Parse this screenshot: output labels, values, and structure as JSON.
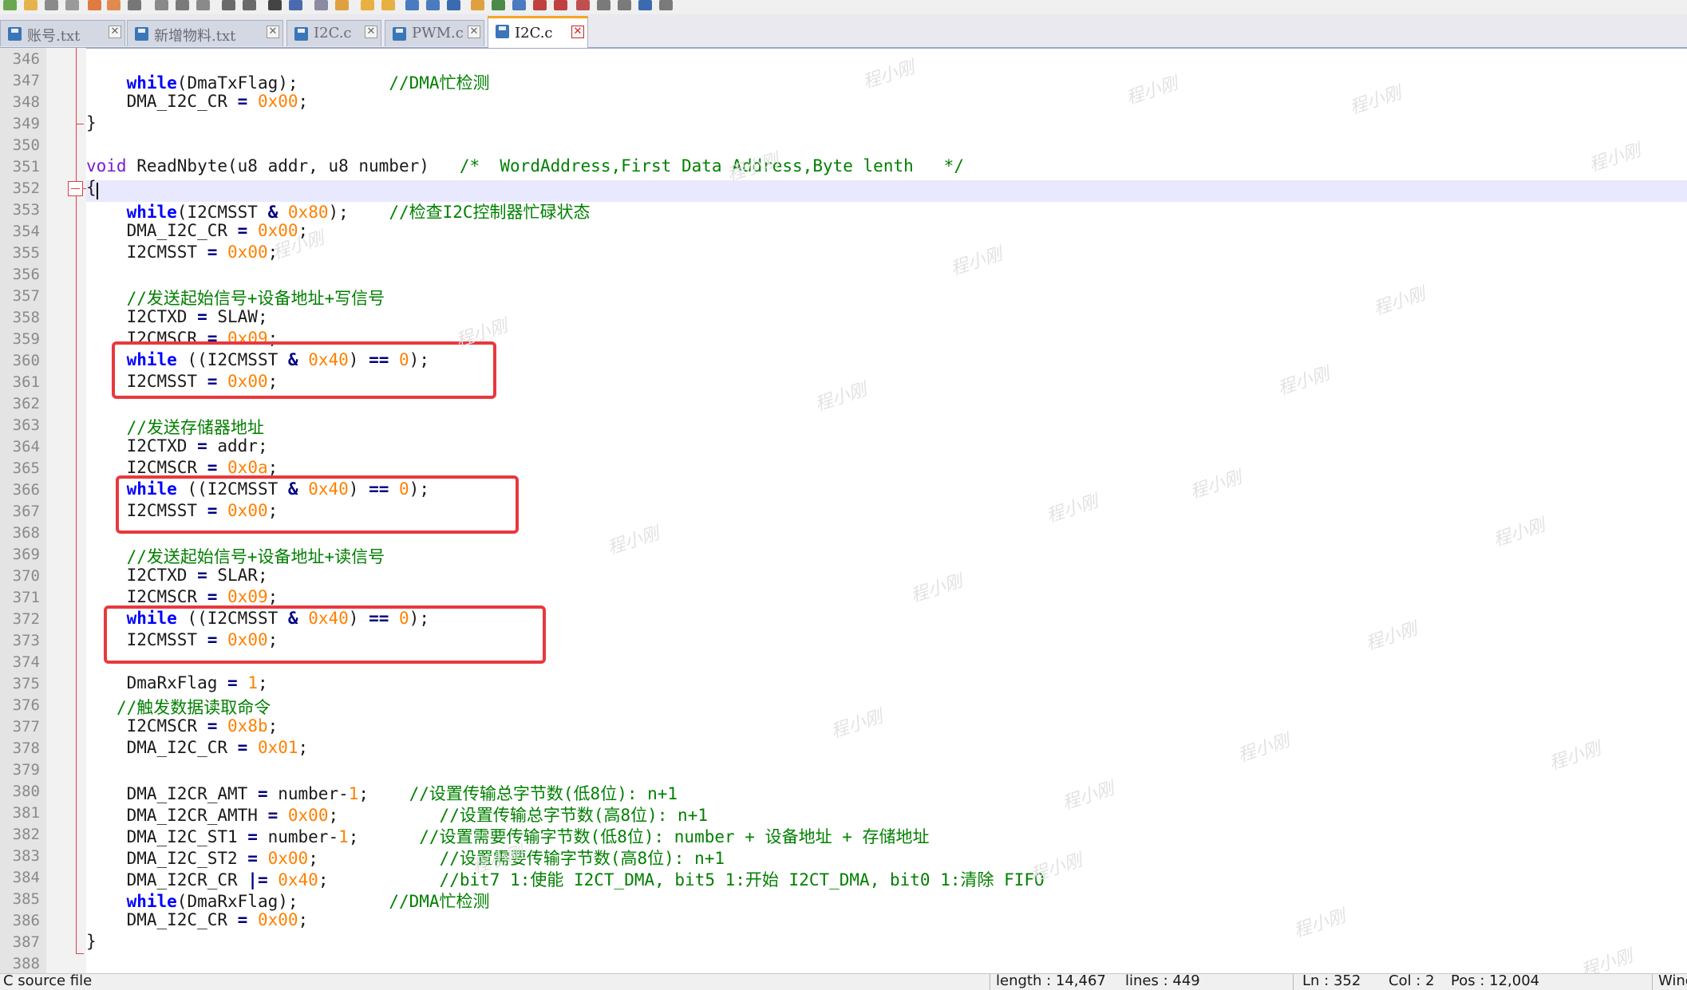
{
  "tabs": [
    {
      "label": "账号.txt",
      "active": false
    },
    {
      "label": "新增物料.txt",
      "active": false
    },
    {
      "label": "I2C.c",
      "active": false
    },
    {
      "label": "PWM.c",
      "active": false
    },
    {
      "label": "I2C.c",
      "active": true
    }
  ],
  "tab_close_glyph": "✕",
  "watermark_text": "程小刚",
  "colors": {
    "keyword": "#0000ff",
    "type": "#7a1cd0",
    "number": "#ff8000",
    "operator": "#000080",
    "comment": "#008000",
    "highlight_box": "#e8383d",
    "current_line": "#e8e8ff"
  },
  "editor": {
    "current_line": 352,
    "lines": [
      {
        "n": "346",
        "t": []
      },
      {
        "n": "347",
        "t": [
          [
            "    ",
            ""
          ],
          [
            "while",
            "kw"
          ],
          [
            "(DmaTxFlag);         ",
            ""
          ],
          [
            "//DMA忙检测",
            "cm"
          ]
        ]
      },
      {
        "n": "348",
        "t": [
          [
            "    DMA_I2C_CR ",
            ""
          ],
          [
            "=",
            "op"
          ],
          [
            " ",
            ""
          ],
          [
            "0x00",
            "num"
          ],
          [
            ";",
            ""
          ]
        ]
      },
      {
        "n": "349",
        "t": [
          [
            "}",
            ""
          ]
        ]
      },
      {
        "n": "350",
        "t": []
      },
      {
        "n": "351",
        "t": [
          [
            "void",
            "ty"
          ],
          [
            " ReadNbyte(u8 addr, u8 number)   ",
            ""
          ],
          [
            "/*  WordAddress,First Data Address,Byte lenth   */",
            "cm"
          ]
        ]
      },
      {
        "n": "352",
        "t": [
          [
            "{",
            ""
          ]
        ]
      },
      {
        "n": "353",
        "t": [
          [
            "    ",
            ""
          ],
          [
            "while",
            "kw"
          ],
          [
            "(I2CMSST ",
            ""
          ],
          [
            "&",
            "op"
          ],
          [
            " ",
            ""
          ],
          [
            "0x80",
            "num"
          ],
          [
            ");    ",
            ""
          ],
          [
            "//检查I2C控制器忙碌状态",
            "cm"
          ]
        ]
      },
      {
        "n": "354",
        "t": [
          [
            "    DMA_I2C_CR ",
            ""
          ],
          [
            "=",
            "op"
          ],
          [
            " ",
            ""
          ],
          [
            "0x00",
            "num"
          ],
          [
            ";",
            ""
          ]
        ]
      },
      {
        "n": "355",
        "t": [
          [
            "    I2CMSST ",
            ""
          ],
          [
            "=",
            "op"
          ],
          [
            " ",
            ""
          ],
          [
            "0x00",
            "num"
          ],
          [
            ";",
            ""
          ]
        ]
      },
      {
        "n": "356",
        "t": []
      },
      {
        "n": "357",
        "t": [
          [
            "    ",
            ""
          ],
          [
            "//发送起始信号+设备地址+写信号",
            "cm"
          ]
        ]
      },
      {
        "n": "358",
        "t": [
          [
            "    I2CTXD ",
            ""
          ],
          [
            "=",
            "op"
          ],
          [
            " SLAW;",
            ""
          ]
        ]
      },
      {
        "n": "359",
        "t": [
          [
            "    I2CMSCR ",
            ""
          ],
          [
            "=",
            "op"
          ],
          [
            " ",
            ""
          ],
          [
            "0x09",
            "num"
          ],
          [
            ";",
            ""
          ]
        ]
      },
      {
        "n": "360",
        "t": [
          [
            "    ",
            ""
          ],
          [
            "while",
            "kw"
          ],
          [
            " ((I2CMSST ",
            ""
          ],
          [
            "&",
            "op"
          ],
          [
            " ",
            ""
          ],
          [
            "0x40",
            "num"
          ],
          [
            ") ",
            ""
          ],
          [
            "==",
            "op"
          ],
          [
            " ",
            ""
          ],
          [
            "0",
            "num"
          ],
          [
            ");",
            ""
          ]
        ]
      },
      {
        "n": "361",
        "t": [
          [
            "    I2CMSST ",
            ""
          ],
          [
            "=",
            "op"
          ],
          [
            " ",
            ""
          ],
          [
            "0x00",
            "num"
          ],
          [
            ";",
            ""
          ]
        ]
      },
      {
        "n": "362",
        "t": []
      },
      {
        "n": "363",
        "t": [
          [
            "    ",
            ""
          ],
          [
            "//发送存储器地址",
            "cm"
          ]
        ]
      },
      {
        "n": "364",
        "t": [
          [
            "    I2CTXD ",
            ""
          ],
          [
            "=",
            "op"
          ],
          [
            " addr;",
            ""
          ]
        ]
      },
      {
        "n": "365",
        "t": [
          [
            "    I2CMSCR ",
            ""
          ],
          [
            "=",
            "op"
          ],
          [
            " ",
            ""
          ],
          [
            "0x0a",
            "num"
          ],
          [
            ";",
            ""
          ]
        ]
      },
      {
        "n": "366",
        "t": [
          [
            "    ",
            ""
          ],
          [
            "while",
            "kw"
          ],
          [
            " ((I2CMSST ",
            ""
          ],
          [
            "&",
            "op"
          ],
          [
            " ",
            ""
          ],
          [
            "0x40",
            "num"
          ],
          [
            ") ",
            ""
          ],
          [
            "==",
            "op"
          ],
          [
            " ",
            ""
          ],
          [
            "0",
            "num"
          ],
          [
            ");",
            ""
          ]
        ]
      },
      {
        "n": "367",
        "t": [
          [
            "    I2CMSST ",
            ""
          ],
          [
            "=",
            "op"
          ],
          [
            " ",
            ""
          ],
          [
            "0x00",
            "num"
          ],
          [
            ";",
            ""
          ]
        ]
      },
      {
        "n": "368",
        "t": []
      },
      {
        "n": "369",
        "t": [
          [
            "    ",
            ""
          ],
          [
            "//发送起始信号+设备地址+读信号",
            "cm"
          ]
        ]
      },
      {
        "n": "370",
        "t": [
          [
            "    I2CTXD ",
            ""
          ],
          [
            "=",
            "op"
          ],
          [
            " SLAR;",
            ""
          ]
        ]
      },
      {
        "n": "371",
        "t": [
          [
            "    I2CMSCR ",
            ""
          ],
          [
            "=",
            "op"
          ],
          [
            " ",
            ""
          ],
          [
            "0x09",
            "num"
          ],
          [
            ";",
            ""
          ]
        ]
      },
      {
        "n": "372",
        "t": [
          [
            "    ",
            ""
          ],
          [
            "while",
            "kw"
          ],
          [
            " ((I2CMSST ",
            ""
          ],
          [
            "&",
            "op"
          ],
          [
            " ",
            ""
          ],
          [
            "0x40",
            "num"
          ],
          [
            ") ",
            ""
          ],
          [
            "==",
            "op"
          ],
          [
            " ",
            ""
          ],
          [
            "0",
            "num"
          ],
          [
            ");",
            ""
          ]
        ]
      },
      {
        "n": "373",
        "t": [
          [
            "    I2CMSST ",
            ""
          ],
          [
            "=",
            "op"
          ],
          [
            " ",
            ""
          ],
          [
            "0x00",
            "num"
          ],
          [
            ";",
            ""
          ]
        ]
      },
      {
        "n": "374",
        "t": []
      },
      {
        "n": "375",
        "t": [
          [
            "    DmaRxFlag ",
            ""
          ],
          [
            "=",
            "op"
          ],
          [
            " ",
            ""
          ],
          [
            "1",
            "num"
          ],
          [
            ";",
            ""
          ]
        ]
      },
      {
        "n": "376",
        "t": [
          [
            "   ",
            ""
          ],
          [
            "//触发数据读取命令",
            "cm"
          ]
        ]
      },
      {
        "n": "377",
        "t": [
          [
            "    I2CMSCR ",
            ""
          ],
          [
            "=",
            "op"
          ],
          [
            " ",
            ""
          ],
          [
            "0x8b",
            "num"
          ],
          [
            ";",
            ""
          ]
        ]
      },
      {
        "n": "378",
        "t": [
          [
            "    DMA_I2C_CR ",
            ""
          ],
          [
            "=",
            "op"
          ],
          [
            " ",
            ""
          ],
          [
            "0x01",
            "num"
          ],
          [
            ";",
            ""
          ]
        ]
      },
      {
        "n": "379",
        "t": []
      },
      {
        "n": "380",
        "t": [
          [
            "    DMA_I2CR_AMT ",
            ""
          ],
          [
            "=",
            "op"
          ],
          [
            " number-",
            ""
          ],
          [
            "1",
            "num"
          ],
          [
            ";    ",
            ""
          ],
          [
            "//设置传输总字节数(低8位): n+1",
            "cm"
          ]
        ]
      },
      {
        "n": "381",
        "t": [
          [
            "    DMA_I2CR_AMTH ",
            ""
          ],
          [
            "=",
            "op"
          ],
          [
            " ",
            ""
          ],
          [
            "0x00",
            "num"
          ],
          [
            ";          ",
            ""
          ],
          [
            "//设置传输总字节数(高8位): n+1",
            "cm"
          ]
        ]
      },
      {
        "n": "382",
        "t": [
          [
            "    DMA_I2C_ST1 ",
            ""
          ],
          [
            "=",
            "op"
          ],
          [
            " number-",
            ""
          ],
          [
            "1",
            "num"
          ],
          [
            ";      ",
            ""
          ],
          [
            "//设置需要传输字节数(低8位): number + 设备地址 + 存储地址",
            "cm"
          ]
        ]
      },
      {
        "n": "383",
        "t": [
          [
            "    DMA_I2C_ST2 ",
            ""
          ],
          [
            "=",
            "op"
          ],
          [
            " ",
            ""
          ],
          [
            "0x00",
            "num"
          ],
          [
            ";            ",
            ""
          ],
          [
            "//设置需要传输字节数(高8位): n+1",
            "cm"
          ]
        ]
      },
      {
        "n": "384",
        "t": [
          [
            "    DMA_I2CR_CR ",
            ""
          ],
          [
            "|=",
            "op"
          ],
          [
            " ",
            ""
          ],
          [
            "0x40",
            "num"
          ],
          [
            ";           ",
            ""
          ],
          [
            "//bit7 1:使能 I2CT_DMA, bit5 1:开始 I2CT_DMA, bit0 1:清除 FIFO",
            "cm"
          ]
        ]
      },
      {
        "n": "385",
        "t": [
          [
            "    ",
            ""
          ],
          [
            "while",
            "kw"
          ],
          [
            "(DmaRxFlag);         ",
            ""
          ],
          [
            "//DMA忙检测",
            "cm"
          ]
        ]
      },
      {
        "n": "386",
        "t": [
          [
            "    DMA_I2C_CR ",
            ""
          ],
          [
            "=",
            "op"
          ],
          [
            " ",
            ""
          ],
          [
            "0x00",
            "num"
          ],
          [
            ";",
            ""
          ]
        ]
      },
      {
        "n": "387",
        "t": [
          [
            "}",
            ""
          ]
        ]
      },
      {
        "n": "388",
        "t": []
      }
    ]
  },
  "status": {
    "file_type": "C source file",
    "length": "length : 14,467",
    "lines": "lines : 449",
    "ln": "Ln : 352",
    "col": "Col : 2",
    "pos": "Pos : 12,004",
    "eol": "Windows (CR LF)"
  }
}
